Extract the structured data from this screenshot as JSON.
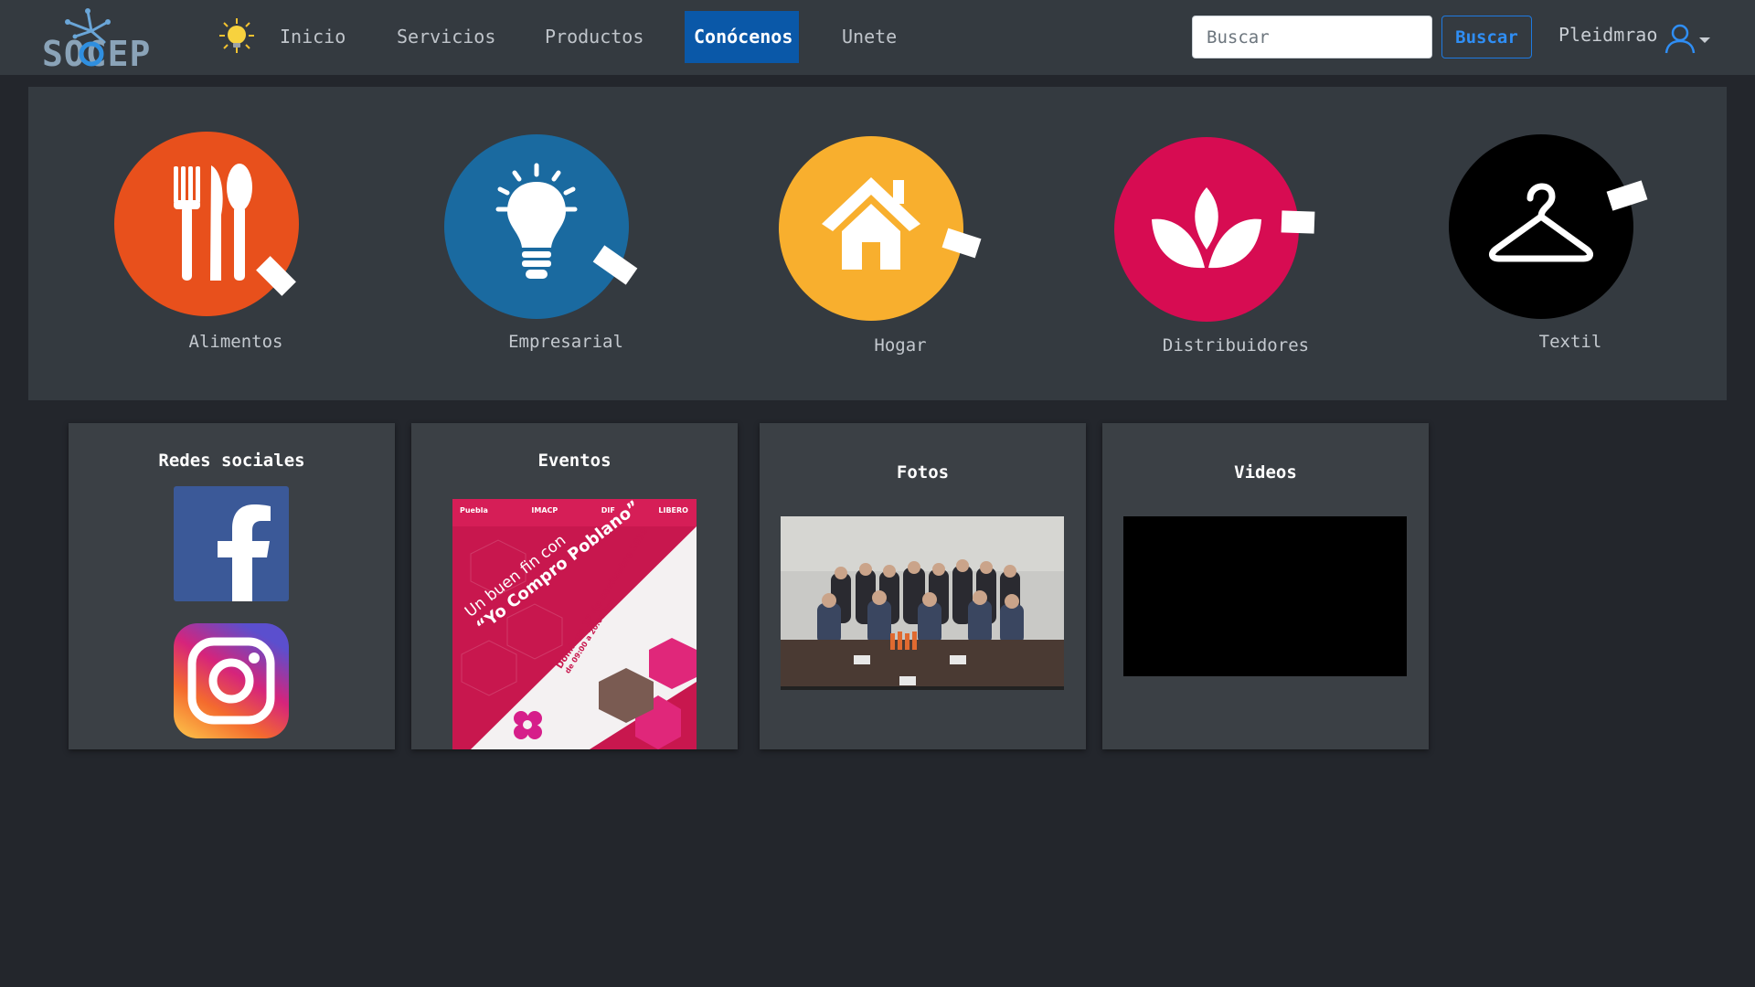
{
  "brand": {
    "logo_text": "SOCEP"
  },
  "nav": {
    "items": [
      {
        "label": "Inicio",
        "active": false
      },
      {
        "label": "Servicios",
        "active": false
      },
      {
        "label": "Productos",
        "active": false
      },
      {
        "label": "Conócenos",
        "active": true
      },
      {
        "label": "Unete",
        "active": false
      }
    ],
    "theme_icon": "sun-icon"
  },
  "search": {
    "placeholder": "Buscar",
    "value": "",
    "button_label": "Buscar"
  },
  "user": {
    "name": "Pleidmrao",
    "icon": "user-icon"
  },
  "categories": [
    {
      "label": "Alimentos",
      "icon": "utensils-icon",
      "color": "#e8501c"
    },
    {
      "label": "Empresarial",
      "icon": "lightbulb-icon",
      "color": "#1a6aa0"
    },
    {
      "label": "Hogar",
      "icon": "house-icon",
      "color": "#f8af2e"
    },
    {
      "label": "Distribuidores",
      "icon": "lotus-icon",
      "color": "#d70c52"
    },
    {
      "label": "Textil",
      "icon": "hanger-icon",
      "color": "#000000"
    }
  ],
  "cards": {
    "social": {
      "title": "Redes sociales",
      "items": [
        "facebook-icon",
        "instagram-icon"
      ]
    },
    "events": {
      "title": "Eventos",
      "flyer": {
        "logos": [
          "Puebla",
          "IMACP",
          "DIF",
          "LIBERO"
        ],
        "headline_1": "Un buen fin con",
        "headline_2": "“Yo Compro Poblano”",
        "date_1": "Domingo 17 de noviembre 2019",
        "date_2": "de 09:00 a 20:00 hrs."
      }
    },
    "photos": {
      "title": "Fotos"
    },
    "videos": {
      "title": "Videos"
    }
  },
  "colors": {
    "page_bg": "#23262c",
    "navbar_bg": "#343a40",
    "active_nav": "#0a58a8",
    "search_button": "#1e7ae0",
    "card_bg": "#3b4045"
  }
}
